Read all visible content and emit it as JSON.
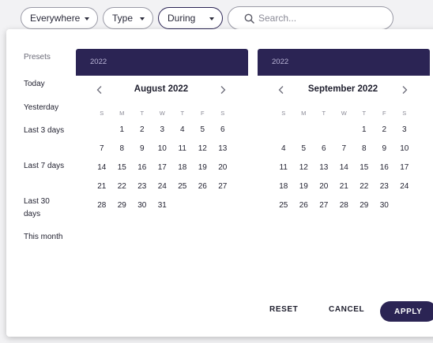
{
  "filters": {
    "location_label": "Everywhere",
    "type_label": "Type",
    "time_label": "During",
    "search_placeholder": "Search..."
  },
  "presets": {
    "title": "Presets",
    "items": [
      "Today",
      "Yesterday",
      "Last 3 days",
      "Last 7 days",
      "Last 30 days",
      "This month"
    ]
  },
  "calendars": [
    {
      "year": "2022",
      "month": "August 2022",
      "weekdays": [
        "S",
        "M",
        "T",
        "W",
        "T",
        "F",
        "S"
      ],
      "leading_blanks": 1,
      "days": [
        1,
        2,
        3,
        4,
        5,
        6,
        7,
        8,
        9,
        10,
        11,
        12,
        13,
        14,
        15,
        16,
        17,
        18,
        19,
        20,
        21,
        22,
        23,
        24,
        25,
        26,
        27,
        28,
        29,
        30,
        31
      ]
    },
    {
      "year": "2022",
      "month": "September 2022",
      "weekdays": [
        "S",
        "M",
        "T",
        "W",
        "T",
        "F",
        "S"
      ],
      "leading_blanks": 4,
      "days": [
        1,
        2,
        3,
        4,
        5,
        6,
        7,
        8,
        9,
        10,
        11,
        12,
        13,
        14,
        15,
        16,
        17,
        18,
        19,
        20,
        21,
        22,
        23,
        24,
        25,
        26,
        27,
        28,
        29,
        30
      ]
    }
  ],
  "actions": {
    "reset": "RESET",
    "cancel": "CANCEL",
    "apply": "APPLY"
  },
  "colors": {
    "accent": "#2b2454",
    "page_bg": "#f2f2f4"
  }
}
